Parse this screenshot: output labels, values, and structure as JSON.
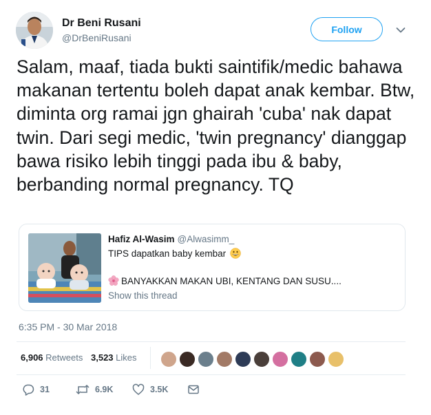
{
  "author": {
    "name": "Dr Beni Rusani",
    "handle": "@DrBeniRusani"
  },
  "follow_label": "Follow",
  "tweet_text": "Salam, maaf, tiada bukti saintifik/medic bahawa makanan tertentu boleh dapat anak kembar. Btw, diminta org ramai jgn ghairah 'cuba' nak dapat twin. Dari segi medic, 'twin pregnancy' dianggap bawa risiko lebih tinggi pada ibu & baby, berbanding normal pregnancy. TQ",
  "quoted": {
    "name": "Hafiz Al-Wasim",
    "handle": "@Alwasimm_",
    "line1": "TIPS dapatkan baby kembar",
    "line2": "BANYAKKAN MAKAN UBI, KENTANG DAN SUSU....",
    "show_thread": "Show this thread"
  },
  "timestamp": "6:35 PM - 30 Mar 2018",
  "stats": {
    "retweets_count": "6,906",
    "retweets_label": "Retweets",
    "likes_count": "3,523",
    "likes_label": "Likes"
  },
  "actions": {
    "replies": "31",
    "retweets": "6.9K",
    "likes": "3.5K"
  },
  "colors": {
    "accent": "#1da1f2",
    "secondary_text": "#657786",
    "border": "#e1e8ed"
  }
}
